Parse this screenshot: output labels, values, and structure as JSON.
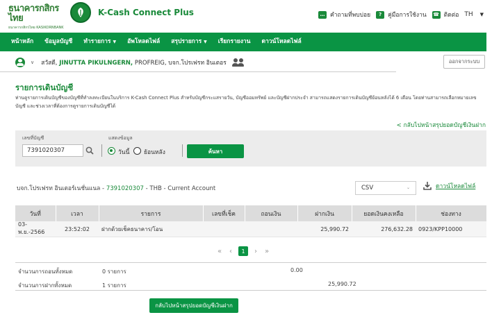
{
  "header": {
    "bank_name_th": "ธนาคารกสิกรไทย",
    "bank_name_en": "ธนาคารกสิกรไทย KASIKORNBANK",
    "app_title": "K-Cash Connect Plus",
    "links": [
      {
        "label": "คำถามที่พบบ่อย",
        "icon": "chat-icon"
      },
      {
        "label": "คู่มือการใช้งาน",
        "icon": "help-icon"
      },
      {
        "label": "ติดต่อ",
        "icon": "contact-icon"
      }
    ],
    "language": "TH"
  },
  "nav": {
    "items": [
      {
        "label": "หน้าหลัก",
        "dropdown": false
      },
      {
        "label": "ข้อมูลบัญชี",
        "dropdown": false
      },
      {
        "label": "ทำรายการ",
        "dropdown": true
      },
      {
        "label": "อัพโหลดไฟล์",
        "dropdown": false
      },
      {
        "label": "สรุปรายการ",
        "dropdown": true
      },
      {
        "label": "เรียกรายงาน",
        "dropdown": false
      },
      {
        "label": "ดาวน์โหลดไฟล์",
        "dropdown": false
      }
    ]
  },
  "user": {
    "greeting": "สวัสดี,",
    "name": "JINUTTA PIKULNGERN,",
    "company": "PROFREIG, บจก.โปรเฟรท อินเตอร"
  },
  "logout_label": "ออกจากระบบ",
  "page": {
    "title": "รายการเดินบัญชี",
    "description": "ท่านดูรายการเดินบัญชีของบัญชีที่ทำลงทะเบียนในบริการ K-Cash Connect Plus สำหรับบัญชีกระแสรายวัน, บัญชีออมทรัพย์ และบัญชีฝากประจำ สามารถแสดงรายการเดินบัญชีย้อนหลังได้ 6 เดือน โดยท่านสามารถเลือกหมายเลขบัญชี และช่วงเวลาที่ต้องการดูรายการเดินบัญชีได้",
    "back_link": "< กลับไปหน้าสรุปยอดบัญชีเงินฝาก"
  },
  "filter": {
    "account_label": "เลขที่บัญชี",
    "account_value": "7391020307",
    "display_label": "แสดงข้อมูล",
    "option_today": "วันนี้",
    "option_past": "ย้อนหลัง",
    "selected": "today",
    "search_button": "ค้นหา"
  },
  "summary": {
    "prefix": "บจก.โปรเฟรท อินเตอร์เนชั่นแนล -",
    "account_no": "7391020307",
    "suffix": "- THB - Current Account",
    "format": "CSV",
    "download_label": "ดาวน์โหลดไฟล์"
  },
  "table": {
    "columns": [
      "วันที่",
      "เวลา",
      "รายการ",
      "เลขที่เช็ค",
      "ถอนเงิน",
      "ฝากเงิน",
      "ยอดเงินคงเหลือ",
      "ช่องทาง"
    ],
    "rows": [
      {
        "date": "03-พ.ย.-2566",
        "time": "23:52:02",
        "desc": "ฝากด้วยเช็คธนาคาร/โอน",
        "cheque": "",
        "withdraw": "",
        "deposit": "25,990.72",
        "balance": "276,632.28",
        "channel": "0923/KPP10000"
      }
    ]
  },
  "pagination": {
    "first": "«",
    "prev": "‹",
    "current": "1",
    "next": "›",
    "last": "»"
  },
  "totals": {
    "withdraw_label": "จำนวนการถอนทั้งหมด",
    "withdraw_count": "0 รายการ",
    "withdraw_amount": "0.00",
    "deposit_label": "จำนวนการฝากทั้งหมด",
    "deposit_count": "1 รายการ",
    "deposit_amount": "25,990.72"
  },
  "back_button": "กลับไปหน้าสรุปยอดบัญชีเงินฝาก",
  "colors": {
    "brand_green": "#0a9444",
    "text_green": "#1a8a3a"
  }
}
